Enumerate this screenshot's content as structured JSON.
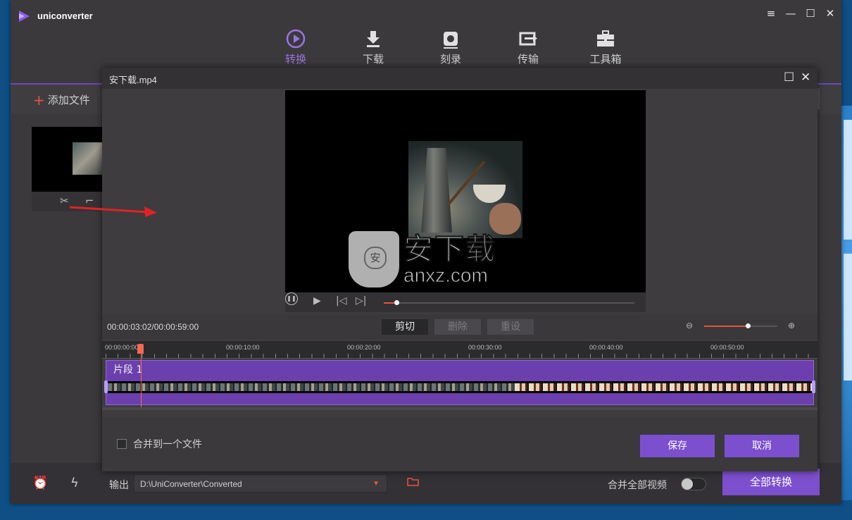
{
  "app": {
    "name": "uniconverter"
  },
  "window_controls": [
    "≡",
    "—",
    "☐",
    "✕"
  ],
  "nav": [
    {
      "label": "转换",
      "icon": "convert-icon",
      "active": true
    },
    {
      "label": "下载",
      "icon": "download-icon",
      "active": false
    },
    {
      "label": "刻录",
      "icon": "burn-icon",
      "active": false
    },
    {
      "label": "传输",
      "icon": "transfer-icon",
      "active": false
    },
    {
      "label": "工具箱",
      "icon": "toolbox-icon",
      "active": false
    }
  ],
  "toolbar": {
    "add_file": "添加文件"
  },
  "bottom": {
    "output_label": "输出",
    "output_path": "D:\\UniConverter\\Converted",
    "merge_all_label": "合并全部视频",
    "convert_all": "全部转换"
  },
  "dialog": {
    "title": "安下载.mp4",
    "timecode": "00:00:03:02/00:00:59:00",
    "buttons": {
      "cut": "剪切",
      "delete": "删除",
      "reset": "重设"
    },
    "ruler_labels": [
      "00:00:00:00",
      "00:00:10:00",
      "00:00:20:00",
      "00:00:30:00",
      "00:00:40:00",
      "00:00:50:00"
    ],
    "clip_label": "片段 1",
    "merge_label": "合并到一个文件",
    "save": "保存",
    "cancel": "取消",
    "playback_progress": 0.05,
    "zoom_level": 0.6
  },
  "watermark": {
    "text_big": "安下载",
    "text_small": "anxz.com"
  },
  "colors": {
    "accent": "#7c4fcf",
    "highlight": "#e5553e",
    "background": "#3b393c"
  }
}
